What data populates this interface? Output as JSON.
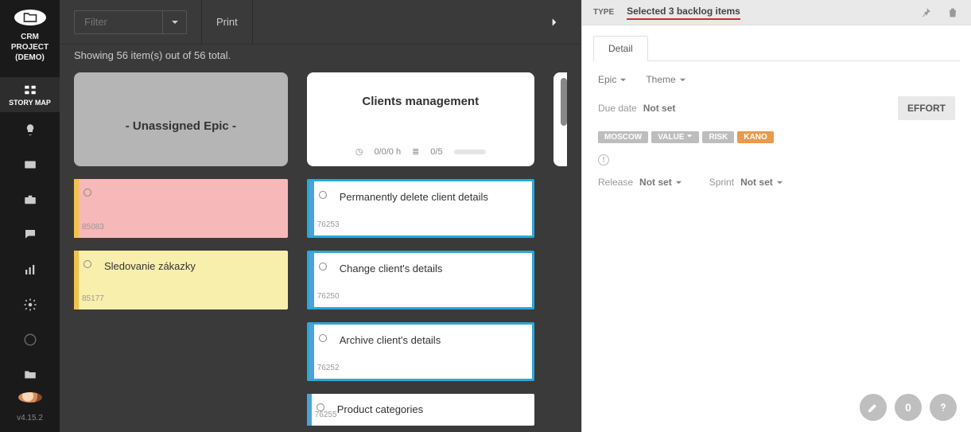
{
  "sidebar": {
    "project_name_l1": "CRM PROJECT",
    "project_name_l2": "(DEMO)",
    "items": [
      {
        "id": "story-map",
        "label": "STORY MAP",
        "icon": "grid-icon"
      },
      {
        "id": "ideas",
        "label": "",
        "icon": "lightbulb-icon"
      },
      {
        "id": "backlog",
        "label": "",
        "icon": "card-icon"
      },
      {
        "id": "sprints",
        "label": "",
        "icon": "briefcase-icon"
      },
      {
        "id": "chat",
        "label": "",
        "icon": "chat-icon"
      },
      {
        "id": "reports",
        "label": "",
        "icon": "chart-icon"
      },
      {
        "id": "settings",
        "label": "",
        "icon": "gear-icon"
      },
      {
        "id": "wheel",
        "label": "",
        "icon": "circle-icon"
      },
      {
        "id": "folder",
        "label": "",
        "icon": "folder-icon"
      }
    ],
    "version": "v4.15.2"
  },
  "topbar": {
    "filter_placeholder": "Filter",
    "print_label": "Print"
  },
  "showing_text": "Showing 56 item(s) out of 56 total.",
  "columns": [
    {
      "header": {
        "title": "- Unassigned Epic -",
        "style": "grey"
      },
      "cards": [
        {
          "id": "85083",
          "title": "",
          "style": "pink"
        },
        {
          "id": "85177",
          "title": "Sledovanie zákazky",
          "style": "yellow"
        }
      ]
    },
    {
      "header": {
        "title": "Clients management",
        "style": "white",
        "time": "0/0/0 h",
        "progress": "0/5"
      },
      "cards": [
        {
          "id": "76253",
          "title": "Permanently delete client details",
          "style": "blue",
          "selected": true
        },
        {
          "id": "76250",
          "title": "Change client's details",
          "style": "blue",
          "selected": true
        },
        {
          "id": "76252",
          "title": "Archive client's details",
          "style": "blue",
          "selected": true
        },
        {
          "id": "76255",
          "title": "Product categories",
          "style": "blue",
          "selected": false
        }
      ]
    }
  ],
  "panel": {
    "type_label": "TYPE",
    "title": "Selected 3 backlog items",
    "tab_detail": "Detail",
    "epic_label": "Epic",
    "theme_label": "Theme",
    "due_label": "Due date",
    "due_value": "Not set",
    "effort_label": "EFFORT",
    "tags": {
      "moscow": "MOSCOW",
      "value": "VALUE",
      "risk": "RISK",
      "kano": "KANO"
    },
    "release_label": "Release",
    "release_value": "Not set",
    "sprint_label": "Sprint",
    "sprint_value": "Not set",
    "count_btn": "0"
  }
}
